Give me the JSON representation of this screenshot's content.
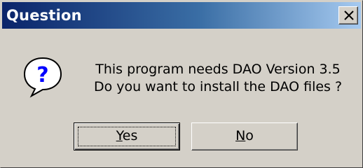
{
  "dialog": {
    "title": "Question",
    "message_line1": "This program needs DAO Version 3.5",
    "message_line2": "Do you want to install the DAO files ?",
    "icon": "question-icon"
  },
  "buttons": {
    "yes": {
      "mnemonic": "Y",
      "rest": "es"
    },
    "no": {
      "mnemonic": "N",
      "rest": "o"
    }
  },
  "colors": {
    "titlebar_start": "#0a246a",
    "titlebar_end": "#a6caf0",
    "face": "#d4d0c8",
    "icon_blue": "#0000ff"
  }
}
